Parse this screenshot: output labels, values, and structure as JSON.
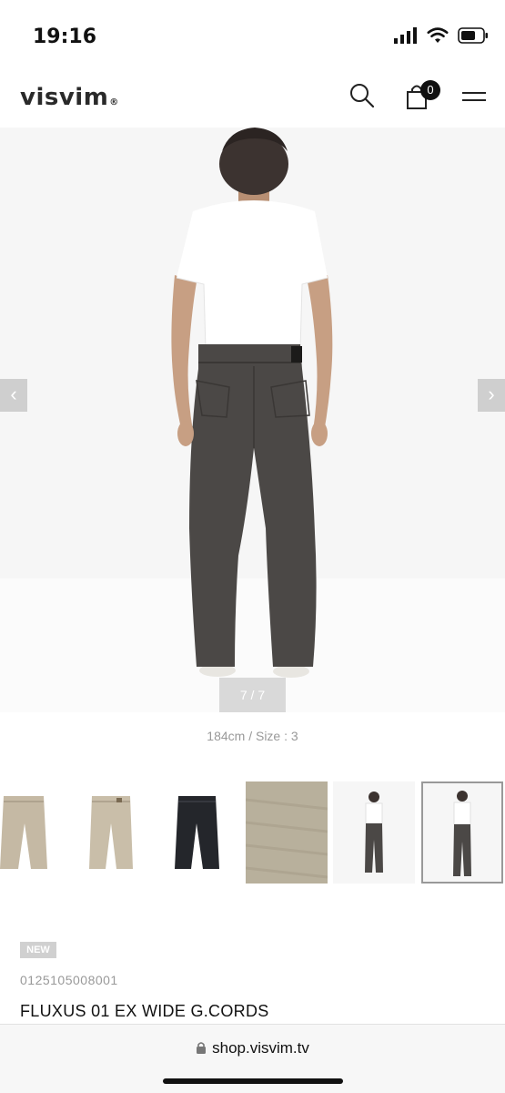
{
  "status_bar": {
    "time": "19:16"
  },
  "header": {
    "logo": "visvim",
    "logo_mark": "®",
    "cart_count": "0"
  },
  "gallery": {
    "counter": "7 / 7",
    "prev_label": "‹",
    "next_label": "›",
    "caption": "184cm / Size : 3",
    "thumbnails": [
      {
        "name": "beige pants front"
      },
      {
        "name": "beige pants back"
      },
      {
        "name": "black pants"
      },
      {
        "name": "fabric detail"
      },
      {
        "name": "model front"
      },
      {
        "name": "model back",
        "active": true
      }
    ]
  },
  "product": {
    "badge": "NEW",
    "sku": "0125105008001",
    "title": "FLUXUS 01 EX WIDE G.CORDS"
  },
  "browser": {
    "url": "shop.visvim.tv"
  },
  "colors": {
    "pants_grey": "#4b4846",
    "pants_beige": "#c5b9a4",
    "pants_black": "#24262b",
    "fabric": "#b8b09c"
  }
}
